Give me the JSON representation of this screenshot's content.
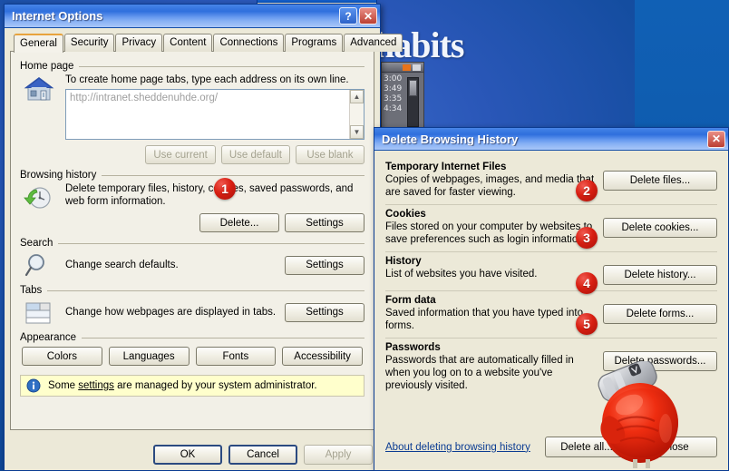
{
  "desktop": {
    "background_word": "habits",
    "gadget_times": [
      "3:00",
      "3:49",
      "3:35",
      "4:34"
    ],
    "colors": {
      "desktop_blue": "#1552ad",
      "accent_orange": "#e8731a"
    }
  },
  "background_window": {
    "close_label": "✕"
  },
  "internet_options": {
    "title": "Internet Options",
    "help_label": "?",
    "close_label": "✕",
    "tabs": [
      {
        "label": "General",
        "active": true
      },
      {
        "label": "Security",
        "active": false
      },
      {
        "label": "Privacy",
        "active": false
      },
      {
        "label": "Content",
        "active": false
      },
      {
        "label": "Connections",
        "active": false
      },
      {
        "label": "Programs",
        "active": false
      },
      {
        "label": "Advanced",
        "active": false
      }
    ],
    "home_page": {
      "group_label": "Home page",
      "icon": "house-icon",
      "description": "To create home page tabs, type each address on its own line.",
      "url_value": "http://intranet.sheddenuhde.org/",
      "scroll_up": "▲",
      "scroll_down": "▼",
      "buttons": [
        {
          "label": "Use current",
          "disabled": true
        },
        {
          "label": "Use default",
          "disabled": true
        },
        {
          "label": "Use blank",
          "disabled": true
        }
      ]
    },
    "browsing_history": {
      "group_label": "Browsing history",
      "icon": "clock-refresh-icon",
      "description": "Delete temporary files, history, cookies, saved passwords, and web form information.",
      "delete_label": "Delete...",
      "settings_label": "Settings"
    },
    "search": {
      "group_label": "Search",
      "icon": "magnifier-icon",
      "description": "Change search defaults.",
      "settings_label": "Settings"
    },
    "tabs_section": {
      "group_label": "Tabs",
      "icon": "tabs-icon",
      "description": "Change how webpages are displayed in tabs.",
      "settings_label": "Settings"
    },
    "appearance": {
      "group_label": "Appearance",
      "buttons": [
        {
          "label": "Colors"
        },
        {
          "label": "Languages"
        },
        {
          "label": "Fonts"
        },
        {
          "label": "Accessibility"
        }
      ]
    },
    "info_bar": {
      "icon": "info-icon",
      "text_before": "Some ",
      "link_text": "settings",
      "text_after": " are managed by your system administrator."
    },
    "footer": {
      "ok_label": "OK",
      "cancel_label": "Cancel",
      "apply_label": "Apply",
      "apply_disabled": true
    }
  },
  "delete_browsing_history": {
    "title": "Delete Browsing History",
    "close_label": "✕",
    "sections": [
      {
        "heading": "Temporary Internet Files",
        "description": "Copies of webpages, images, and media that are saved for faster viewing.",
        "button_label": "Delete files..."
      },
      {
        "heading": "Cookies",
        "description": "Files stored on your computer by websites to save preferences such as login information.",
        "button_label": "Delete cookies..."
      },
      {
        "heading": "History",
        "description": "List of websites you have visited.",
        "button_label": "Delete history..."
      },
      {
        "heading": "Form data",
        "description": "Saved information that you have typed into forms.",
        "button_label": "Delete forms..."
      },
      {
        "heading": "Passwords",
        "description": "Passwords that are automatically filled in when you log on to a website you've previously visited.",
        "button_label": "Delete passwords..."
      }
    ],
    "footer": {
      "link_label": "About deleting browsing history",
      "delete_all_label": "Delete all...",
      "close_label": "Close"
    }
  },
  "annotations": {
    "badges": [
      {
        "number": "1",
        "target": "delete-browsing-history-button"
      },
      {
        "number": "2",
        "target": "delete-files-button"
      },
      {
        "number": "3",
        "target": "delete-cookies-button"
      },
      {
        "number": "4",
        "target": "delete-history-button"
      },
      {
        "number": "5",
        "target": "delete-forms-button"
      }
    ],
    "badge_color": "#d81f12"
  },
  "overlay": {
    "boxing_glove": "boxing-glove-image"
  }
}
